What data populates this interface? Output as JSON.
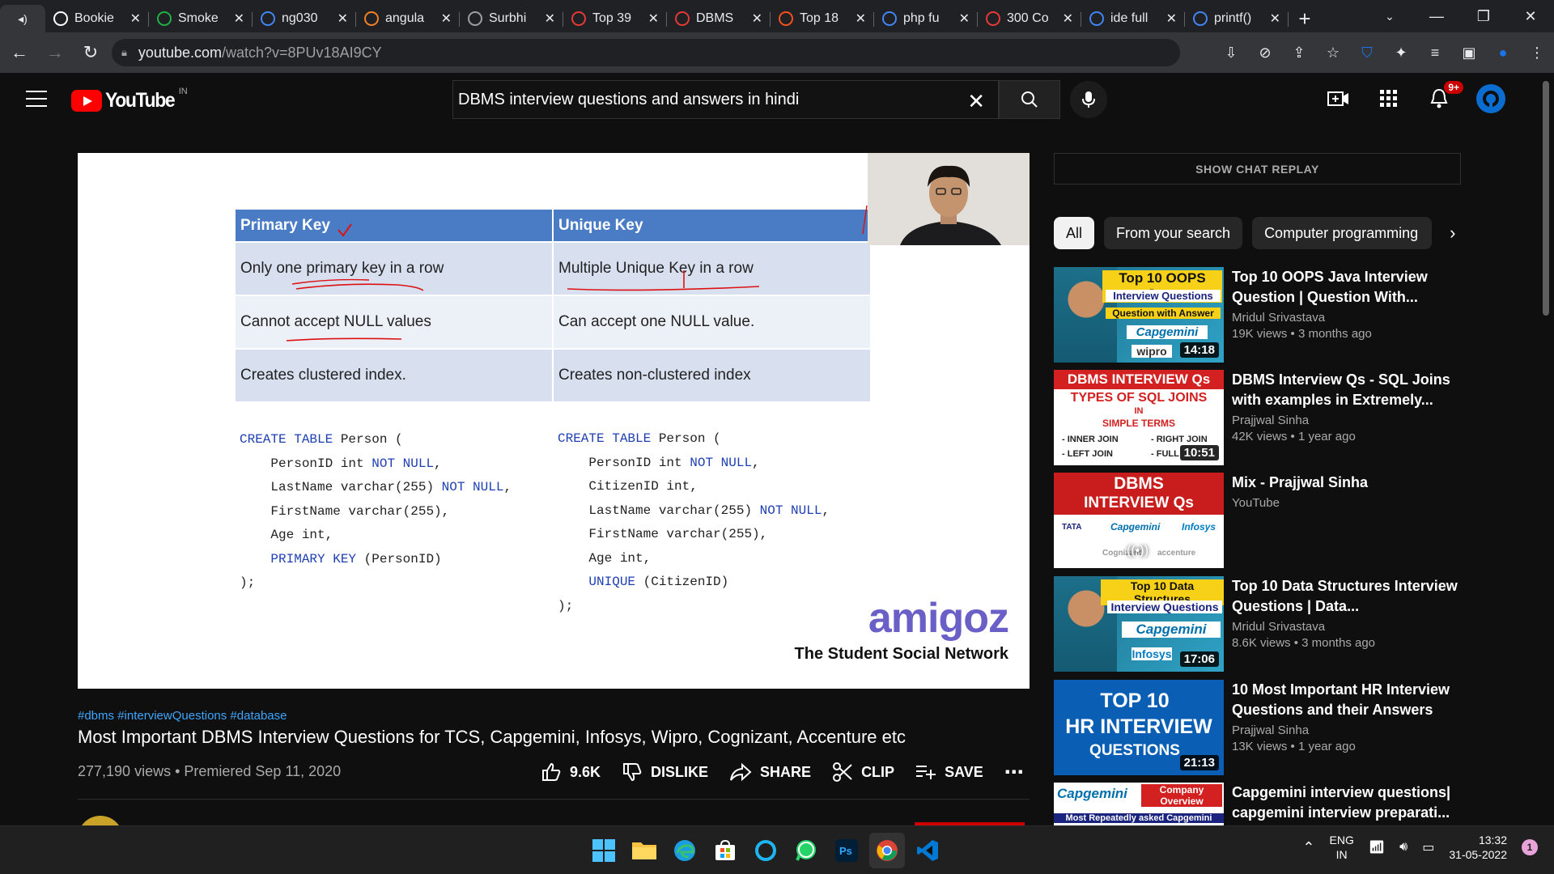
{
  "browser": {
    "tabs": [
      {
        "label": "Bookie",
        "icon": "bookie-icon",
        "color": "#ffffff"
      },
      {
        "label": "Smoke",
        "icon": "px-icon",
        "color": "#1fb141"
      },
      {
        "label": "ng030",
        "icon": "google-icon",
        "color": "#4285f4"
      },
      {
        "label": "angula",
        "icon": "stackoverflow-icon",
        "color": "#f48024"
      },
      {
        "label": "Surbhi",
        "icon": "globe-icon",
        "color": "#9aa0a6"
      },
      {
        "label": "Top 39",
        "icon": "v-icon",
        "color": "#e53935"
      },
      {
        "label": "DBMS",
        "icon": "v-icon",
        "color": "#e53935"
      },
      {
        "label": "Top 18",
        "icon": "orange-circle-icon",
        "color": "#f4511e"
      },
      {
        "label": "php fu",
        "icon": "google-icon",
        "color": "#4285f4"
      },
      {
        "label": "300 Co",
        "icon": "v-icon",
        "color": "#e53935"
      },
      {
        "label": "ide full",
        "icon": "google-icon",
        "color": "#4285f4"
      },
      {
        "label": "printf()",
        "icon": "google-icon",
        "color": "#4285f4"
      }
    ],
    "url_host": "youtube.com",
    "url_path": "/watch?v=8PUv18AI9CY"
  },
  "youtube": {
    "logo_text": "YouTube",
    "country_code": "IN",
    "search_query": "DBMS interview questions and answers in hindi",
    "notification_count": "9+"
  },
  "slide": {
    "headers": [
      "Primary Key",
      "Unique Key"
    ],
    "rows": [
      [
        "Only one primary key in a row",
        "Multiple Unique Key in a row"
      ],
      [
        "Cannot accept NULL values",
        "Can accept one NULL value."
      ],
      [
        "Creates clustered index.",
        "Creates non-clustered index"
      ]
    ],
    "code_left": [
      "CREATE TABLE Person (",
      "    PersonID int NOT NULL,",
      "    LastName varchar(255) NOT NULL,",
      "    FirstName varchar(255),",
      "    Age int,",
      "    PRIMARY KEY (PersonID)",
      ");"
    ],
    "code_right": [
      "CREATE TABLE Person (",
      "    PersonID int NOT NULL,",
      "    CitizenID int,",
      "    LastName varchar(255) NOT NULL,",
      "    FirstName varchar(255),",
      "    Age int,",
      "    UNIQUE (CitizenID)",
      ");"
    ],
    "brand": "amigoz",
    "tagline": "The Student Social Network"
  },
  "video": {
    "hashtags": "#dbms #interviewQuestions #database",
    "title": "Most Important DBMS Interview Questions for TCS, Capgemini, Infosys, Wipro, Cognizant, Accenture etc",
    "stats": "277,190 views • Premiered Sep 11, 2020",
    "likes": "9.6K",
    "dislike_label": "DISLIKE",
    "share_label": "SHARE",
    "clip_label": "CLIP",
    "save_label": "SAVE"
  },
  "sidebar": {
    "chat_replay": "SHOW CHAT REPLAY",
    "chips": [
      "All",
      "From your search",
      "Computer programming"
    ],
    "recommendations": [
      {
        "title": "Top 10 OOPS Java Interview Question | Question With...",
        "channel": "Mridul Srivastava",
        "stats": "19K views • 3 months ago",
        "duration": "14:18",
        "thumb_lines": [
          "Top 10 OOPS Java",
          "Interview Questions",
          "Question with Answer",
          "Capgemini",
          "wipro"
        ]
      },
      {
        "title": "DBMS Interview Qs - SQL Joins with examples in Extremely...",
        "channel": "Prajjwal Sinha",
        "stats": "42K views • 1 year ago",
        "duration": "10:51",
        "thumb_lines": [
          "DBMS INTERVIEW Qs",
          "TYPES OF SQL JOINS",
          "IN",
          "SIMPLE TERMS",
          "- INNER JOIN",
          "- RIGHT JOIN",
          "- LEFT JOIN",
          "- FULL"
        ]
      },
      {
        "title": "Mix - Prajjwal Sinha",
        "channel": "YouTube",
        "stats": "",
        "duration": "",
        "thumb_lines": [
          "DBMS",
          "INTERVIEW Qs",
          "TATA",
          "Capgemini",
          "Infosys",
          "Cognizant",
          "accenture"
        ]
      },
      {
        "title": "Top 10 Data Structures Interview Questions | Data...",
        "channel": "Mridul Srivastava",
        "stats": "8.6K views • 3 months ago",
        "duration": "17:06",
        "thumb_lines": [
          "Top 10 Data Structures",
          "Interview Questions",
          "Capgemini",
          "Infosys"
        ]
      },
      {
        "title": "10 Most Important HR Interview Questions and their Answers",
        "channel": "Prajjwal Sinha",
        "stats": "13K views • 1 year ago",
        "duration": "21:13",
        "thumb_lines": [
          "TOP 10",
          "HR INTERVIEW",
          "QUESTIONS"
        ]
      },
      {
        "title": "Capgemini interview questions| capgemini interview preparati...",
        "channel": "",
        "stats": "",
        "duration": "",
        "thumb_lines": [
          "Capgemini",
          "Company",
          "Overview",
          "Most Repeatedly asked Capgemini"
        ]
      }
    ]
  },
  "taskbar": {
    "lang_line1": "ENG",
    "lang_line2": "IN",
    "time": "13:32",
    "date": "31-05-2022",
    "notification_count": "1"
  }
}
